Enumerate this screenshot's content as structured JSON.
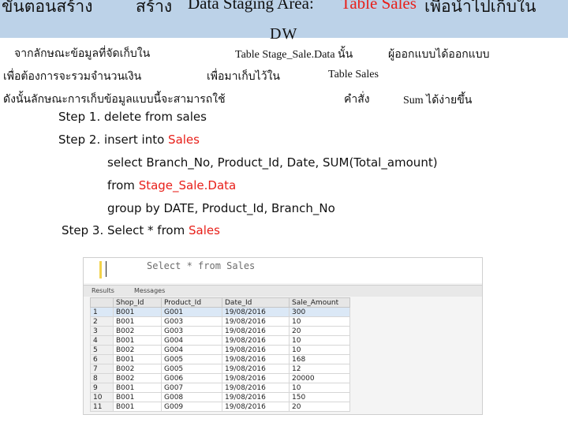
{
  "title": {
    "part1": "ขั้นตอนสร้าง",
    "part2": "สร้าง",
    "part3": "Data Staging Area:",
    "part4": "Table Sales",
    "part5": "เพื่อนำไปเก็บใน",
    "part6": "DW"
  },
  "description": {
    "line1": [
      "จากลักษณะข้อมูลที่จัดเก็บใน",
      "Table Stage_Sale.Data นั้น",
      "ผู้ออกแบบได้ออกแบบ"
    ],
    "line2": [
      "เพื่อต้องการจะรวมจำนวนเงิน",
      "เพื่อมาเก็บไว้ใน",
      "Table Sales"
    ],
    "line3": [
      "ดังนั้นลักษณะการเก็บข้อมูลแบบนี้จะสามารถใช้",
      "คำสั่ง",
      "Sum ได้ง่ายขึ้น"
    ]
  },
  "steps": {
    "s1": "Step 1. delete from sales",
    "s2_prefix": "Step 2. insert into ",
    "s2_kw": "Sales",
    "select_line": "select Branch_No, Product_Id, Date, SUM(Total_amount)",
    "from_prefix": "from ",
    "from_kw": "Stage_Sale.Data",
    "group_line": "group by DATE, Product_Id, Branch_No",
    "s3_prefix": "Step 3. Select * from ",
    "s3_kw": "Sales"
  },
  "sql_window": {
    "query": "Select * from Sales",
    "tabs": [
      "Results",
      "Messages"
    ],
    "columns": [
      "",
      "Shop_Id",
      "Product_Id",
      "Date_Id",
      "Sale_Amount"
    ],
    "rows": [
      [
        "1",
        "B001",
        "G001",
        "19/08/2016",
        "300"
      ],
      [
        "2",
        "B001",
        "G003",
        "19/08/2016",
        "10"
      ],
      [
        "3",
        "B002",
        "G003",
        "19/08/2016",
        "20"
      ],
      [
        "4",
        "B001",
        "G004",
        "19/08/2016",
        "10"
      ],
      [
        "5",
        "B002",
        "G004",
        "19/08/2016",
        "10"
      ],
      [
        "6",
        "B001",
        "G005",
        "19/08/2016",
        "168"
      ],
      [
        "7",
        "B002",
        "G005",
        "19/08/2016",
        "12"
      ],
      [
        "8",
        "B002",
        "G006",
        "19/08/2016",
        "20000"
      ],
      [
        "9",
        "B001",
        "G007",
        "19/08/2016",
        "10"
      ],
      [
        "10",
        "B001",
        "G008",
        "19/08/2016",
        "150"
      ],
      [
        "11",
        "B001",
        "G009",
        "19/08/2016",
        "20"
      ]
    ]
  },
  "colors": {
    "banner": "#bcd2e8",
    "keyword_red": "#e8201a"
  }
}
